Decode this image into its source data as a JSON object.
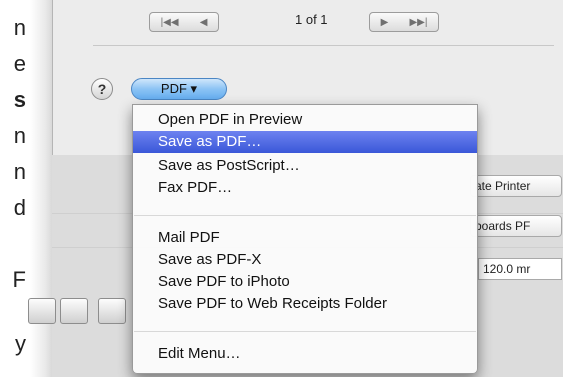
{
  "left_page": {
    "chars": [
      "n",
      "e",
      "s",
      "n",
      "n",
      "d",
      "F",
      "y"
    ]
  },
  "dialog": {
    "page_indicator": "1 of 1",
    "help_label": "?",
    "pdf_button_label": "PDF ▾",
    "background_fields": {
      "printer_popup": "ate Printer",
      "paper_popup": "boards PF",
      "size_field": "120.0 mr"
    }
  },
  "pdf_menu": {
    "items_group1": [
      "Open PDF in Preview",
      "Save as PDF…",
      "Save as PostScript…",
      "Fax PDF…"
    ],
    "items_group2": [
      "Mail PDF",
      "Save as PDF-X",
      "Save PDF to iPhoto",
      "Save PDF to Web Receipts Folder"
    ],
    "items_group3": [
      "Edit Menu…"
    ],
    "selected": "Save as PDF…"
  },
  "colors": {
    "selection": "#3a57d8",
    "pdf_button": "#66aef0"
  }
}
